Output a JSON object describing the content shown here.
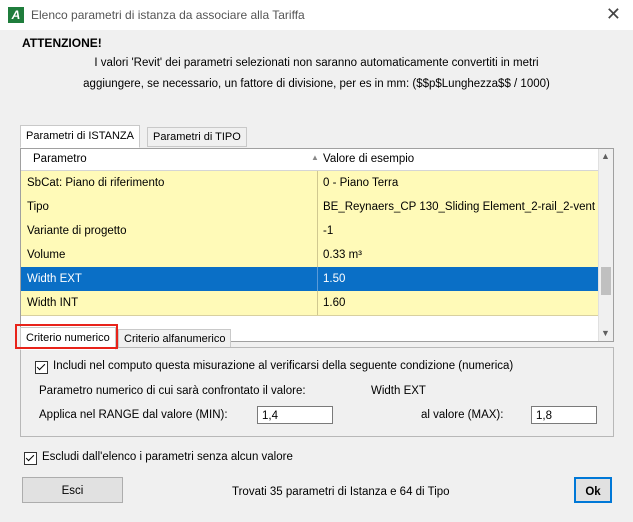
{
  "window": {
    "title": "Elenco parametri di istanza da associare alla Tariffa",
    "app_icon_letter": "A",
    "close_glyph": "✕"
  },
  "warning": {
    "heading": "ATTENZIONE!",
    "line1": "I valori 'Revit' dei parametri selezionati non saranno automaticamente convertiti in metri",
    "line2": "aggiungere, se necessario, un fattore di divisione, per es in mm: ($$p$Lunghezza$$ / 1000)"
  },
  "top_tabs": [
    {
      "label": "Parametri di ISTANZA",
      "active": true
    },
    {
      "label": "Parametri di TIPO",
      "active": false
    }
  ],
  "grid": {
    "columns": [
      "Parametro",
      "Valore di esempio"
    ],
    "rows": [
      {
        "param": "SbCat: Piano di riferimento",
        "value": "0 - Piano Terra",
        "selected": false
      },
      {
        "param": "Tipo",
        "value": "BE_Reynaers_CP 130_Sliding Element_2-rail_2-vent",
        "selected": false
      },
      {
        "param": "Variante di progetto",
        "value": "-1",
        "selected": false
      },
      {
        "param": "Volume",
        "value": "0.33 m³",
        "selected": false
      },
      {
        "param": "Width EXT",
        "value": "1.50",
        "selected": true
      },
      {
        "param": "Width INT",
        "value": "1.60",
        "selected": false
      }
    ]
  },
  "criteria_tabs": [
    {
      "label": "Criterio numerico",
      "active": true
    },
    {
      "label": "Criterio alfanumerico",
      "active": false
    }
  ],
  "criteria": {
    "include_label": "Includi nel computo questa misurazione al verificarsi della seguente condizione (numerica)",
    "include_checked": true,
    "compare_label": "Parametro numerico di cui sarà confrontato il valore:",
    "compare_value": "Width EXT",
    "range_label": "Applica nel RANGE dal valore (MIN):",
    "min_value": "1,4",
    "max_label": "al valore (MAX):",
    "max_value": "1,8"
  },
  "exclude": {
    "label": "Escludi dall'elenco i parametri senza alcun valore",
    "checked": true
  },
  "footer": {
    "exit_label": "Esci",
    "status": "Trovati 35 parametri di Istanza e 64 di Tipo",
    "ok_label": "Ok"
  }
}
